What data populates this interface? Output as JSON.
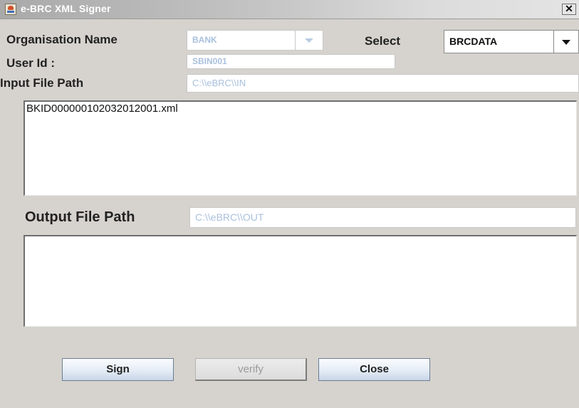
{
  "window": {
    "title": "e-BRC XML Signer",
    "close_glyph": "✕"
  },
  "form": {
    "org_label": "Organisation Name",
    "org_value": "BANK",
    "select_label": "Select",
    "select_value": "BRCDATA",
    "userid_label": "User Id :",
    "userid_value": "SBIN001",
    "input_path_label": "Input File Path",
    "input_path_value": "C:\\\\eBRC\\\\IN",
    "input_files": [
      "BKID000000102032012001.xml"
    ],
    "output_path_label": "Output File Path",
    "output_path_value": "C:\\\\eBRC\\\\OUT"
  },
  "buttons": {
    "sign": "Sign",
    "verify": "verify",
    "close": "Close"
  },
  "colors": {
    "disabled_text": "#a9c0de",
    "window_bg": "#d6d3ce"
  }
}
